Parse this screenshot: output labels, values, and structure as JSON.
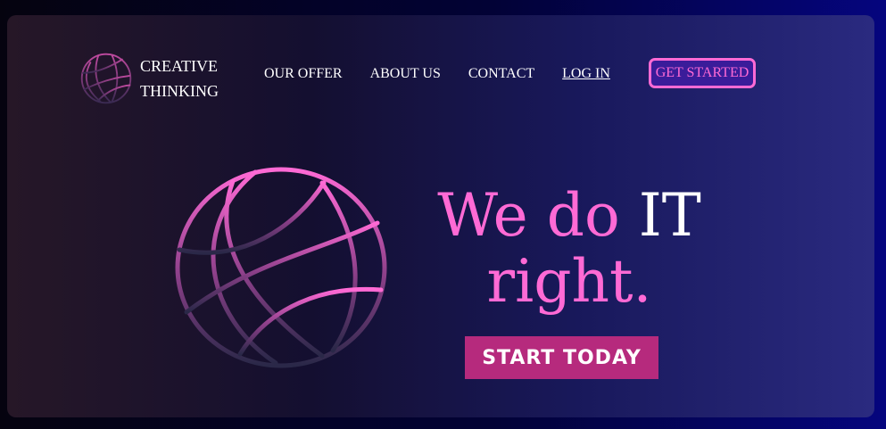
{
  "brand": {
    "line1": "CREATIVE",
    "line2": "THINKING",
    "icon": "globe-icon"
  },
  "nav": {
    "items": [
      "OUR OFFER",
      "ABOUT US",
      "CONTACT",
      "LOG IN"
    ],
    "cta_label": "GET STARTED"
  },
  "hero": {
    "headline_part1": "We do ",
    "headline_accent": "IT",
    "headline_part2": "right.",
    "cta_label": "START TODAY",
    "icon": "globe-icon"
  },
  "colors": {
    "accent_pink": "#ff6ad5",
    "cta_bg": "#b62a7d",
    "text_white": "#ffffff"
  }
}
